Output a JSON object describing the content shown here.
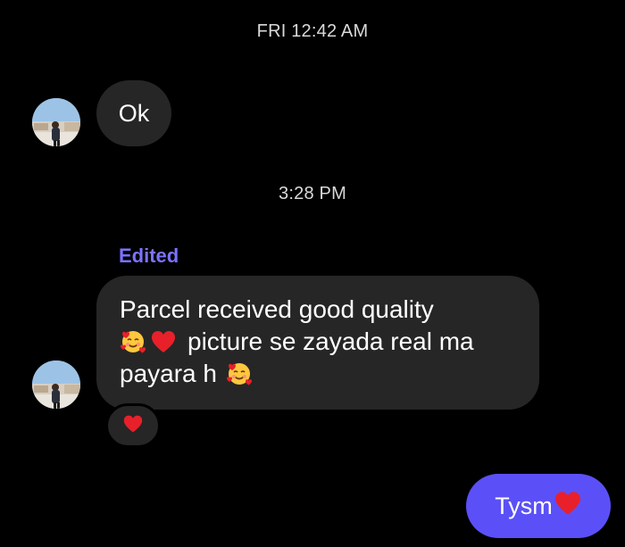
{
  "conversation": {
    "timestamps": [
      "FRI 12:42 AM",
      "3:28 PM"
    ],
    "messages": [
      {
        "direction": "incoming",
        "text": "Ok"
      },
      {
        "direction": "incoming",
        "edited_label": "Edited",
        "lines": [
          "Parcel received good quality",
          "picture se zayada real ma",
          "payara h"
        ],
        "emojis": [
          "smiling-face-with-hearts",
          "red-heart",
          "smiling-face-with-hearts"
        ],
        "reaction": "red-heart"
      },
      {
        "direction": "outgoing",
        "text": "Tysm",
        "emoji": "red-heart"
      }
    ]
  },
  "colors": {
    "background": "#000000",
    "incoming_bubble": "#262626",
    "outgoing_bubble": "#5b50f7",
    "edited_label": "#7a73ff",
    "timestamp": "#d9d9d9",
    "heart": "#e8202a"
  }
}
